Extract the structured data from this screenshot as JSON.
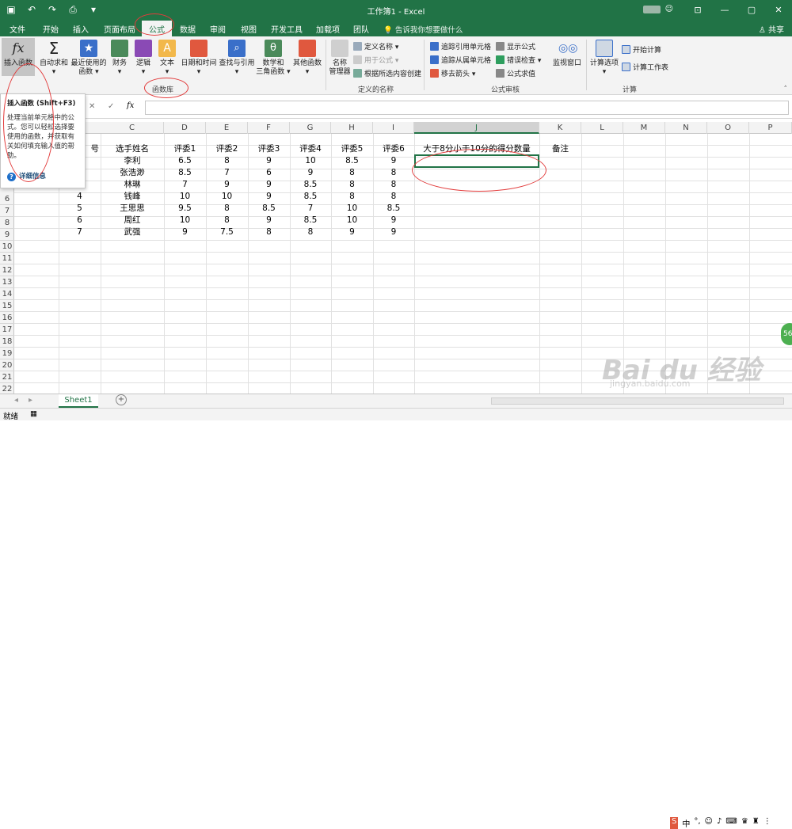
{
  "titlebar": {
    "title": "工作簿1 - Excel",
    "controls": [
      "restore-icon",
      "minimize-icon",
      "maximize-icon",
      "close-icon"
    ]
  },
  "tabs": [
    "文件",
    "开始",
    "插入",
    "页面布局",
    "公式",
    "数据",
    "审阅",
    "视图",
    "开发工具",
    "加载项",
    "团队"
  ],
  "active_tab": "公式",
  "tellme": "告诉我你想要做什么",
  "share": "共享",
  "ribbon": {
    "insert_function": "插入函数",
    "autosum": [
      "自动求和",
      "▾"
    ],
    "recent": [
      "最近使用的",
      "函数 ▾"
    ],
    "financial": [
      "财务",
      "▾"
    ],
    "logical": [
      "逻辑",
      "▾"
    ],
    "text": [
      "文本",
      "▾"
    ],
    "datetime": [
      "日期和时间",
      "▾"
    ],
    "lookup": [
      "查找与引用",
      "▾"
    ],
    "math": [
      "数学和",
      "三角函数 ▾"
    ],
    "more": [
      "其他函数",
      "▾"
    ],
    "name_manager": [
      "名称",
      "管理器"
    ],
    "define_name": "定义名称 ▾",
    "use_in_formula": "用于公式 ▾",
    "create_from_selection": "根据所选内容创建",
    "trace_precedents": "追踪引用单元格",
    "trace_dependents": "追踪从属单元格",
    "remove_arrows": "移去箭头 ▾",
    "show_formulas": "显示公式",
    "error_checking": "错误检查 ▾",
    "evaluate_formula": "公式求值",
    "watch_window": "监视窗口",
    "calc_options": [
      "计算选项",
      "▾"
    ],
    "calc_now": "开始计算",
    "calc_sheet": "计算工作表",
    "groups": [
      "函数库",
      "定义的名称",
      "公式审核",
      "计算"
    ]
  },
  "tooltip": {
    "title": "插入函数 (Shift+F3)",
    "body": "处理当前单元格中的公式。您可以轻松选择要使用的函数，并获取有关如何填充输入值的帮助。",
    "link": "详细信息"
  },
  "formula_bar": {
    "cancel": "✕",
    "enter": "✓",
    "fx": "fx",
    "value": ""
  },
  "columns": [
    "C",
    "D",
    "E",
    "F",
    "G",
    "H",
    "I",
    "J",
    "K",
    "L",
    "M",
    "N",
    "O",
    "P"
  ],
  "rows": [
    "6",
    "7",
    "8",
    "9",
    "10",
    "11",
    "12",
    "13",
    "14",
    "15",
    "16",
    "17",
    "18",
    "19",
    "20",
    "21",
    "22"
  ],
  "table": {
    "headers": [
      "选手姓名",
      "评委1",
      "评委2",
      "评委3",
      "评委4",
      "评委5",
      "评委6",
      "大于8分小于10分的得分数量",
      "备注"
    ],
    "col_b_partial": "号",
    "data": [
      [
        "",
        "李利",
        "6.5",
        "8",
        "9",
        "10",
        "8.5",
        "9"
      ],
      [
        "",
        "张浩渺",
        "8.5",
        "7",
        "6",
        "9",
        "8",
        "8"
      ],
      [
        "",
        "林琳",
        "7",
        "9",
        "9",
        "8.5",
        "8",
        "8"
      ],
      [
        "4",
        "钱峰",
        "10",
        "10",
        "9",
        "8.5",
        "8",
        "8"
      ],
      [
        "5",
        "王思思",
        "9.5",
        "8",
        "8.5",
        "7",
        "10",
        "8.5"
      ],
      [
        "6",
        "周红",
        "10",
        "8",
        "9",
        "8.5",
        "10",
        "9"
      ],
      [
        "7",
        "武强",
        "9",
        "7.5",
        "8",
        "8",
        "9",
        "9"
      ]
    ]
  },
  "sheet": "Sheet1",
  "status": "就绪",
  "watermark": "Bai du 经验",
  "watermark_url": "jingyan.baidu.com",
  "float_badge": "56"
}
